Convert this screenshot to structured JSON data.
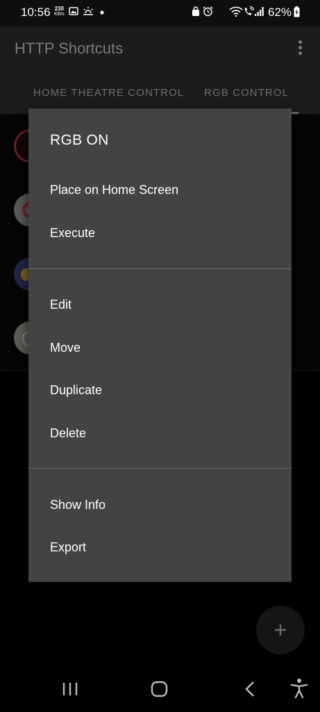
{
  "status_bar": {
    "time": "10:56",
    "net_speed_value": "230",
    "net_speed_unit": "KB/s",
    "battery": "62%"
  },
  "app": {
    "title": "HTTP Shortcuts",
    "tabs": [
      {
        "label": "HOME THEATRE CONTROL"
      },
      {
        "label": "RGB CONTROL"
      }
    ]
  },
  "menu": {
    "title": "RGB ON",
    "groups": [
      [
        "Place on Home Screen",
        "Execute"
      ],
      [
        "Edit",
        "Move",
        "Duplicate",
        "Delete"
      ],
      [
        "Show Info",
        "Export"
      ]
    ]
  },
  "colors": {
    "menu_bg": "#434343",
    "divider": "#6a6a6a",
    "scrim_text": "#7a7a7a"
  }
}
